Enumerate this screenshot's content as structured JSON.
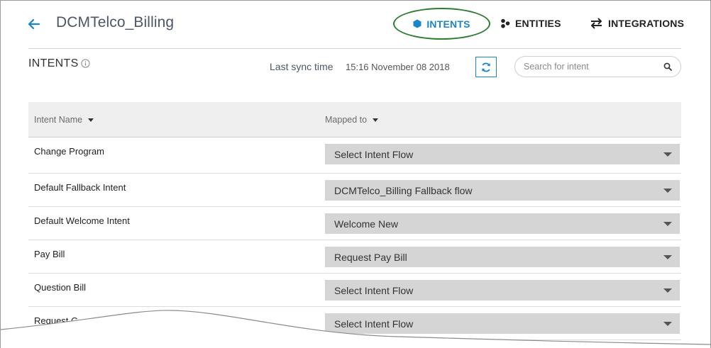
{
  "header": {
    "app_title": "DCMTelco_Billing",
    "nav": [
      {
        "label": "INTENTS",
        "icon": "hexagon-icon",
        "active": true,
        "color": "#1a86c8"
      },
      {
        "label": "ENTITIES",
        "icon": "entities-icon",
        "active": false
      },
      {
        "label": "INTEGRATIONS",
        "icon": "swap-arrows-icon",
        "active": false
      }
    ],
    "highlight_color": "#2e7d32"
  },
  "subheader": {
    "title": "INTENTS",
    "sync_label": "Last sync time",
    "sync_time": "15:16 November 08 2018",
    "search_placeholder": "Search for intent"
  },
  "table": {
    "columns": [
      "Intent Name",
      "Mapped to"
    ],
    "rows": [
      {
        "name": "Change Program",
        "mapped": "Select Intent Flow"
      },
      {
        "name": "Default Fallback Intent",
        "mapped": "DCMTelco_Billing Fallback flow"
      },
      {
        "name": "Default Welcome Intent",
        "mapped": "Welcome New"
      },
      {
        "name": "Pay Bill",
        "mapped": "Request Pay Bill"
      },
      {
        "name": "Question Bill",
        "mapped": "Select Intent Flow"
      },
      {
        "name": "Request C",
        "mapped": "Select Intent Flow"
      }
    ]
  },
  "colors": {
    "accent": "#1a86c8",
    "select_bg": "#d5d5d5",
    "header_bg": "#efefef"
  }
}
